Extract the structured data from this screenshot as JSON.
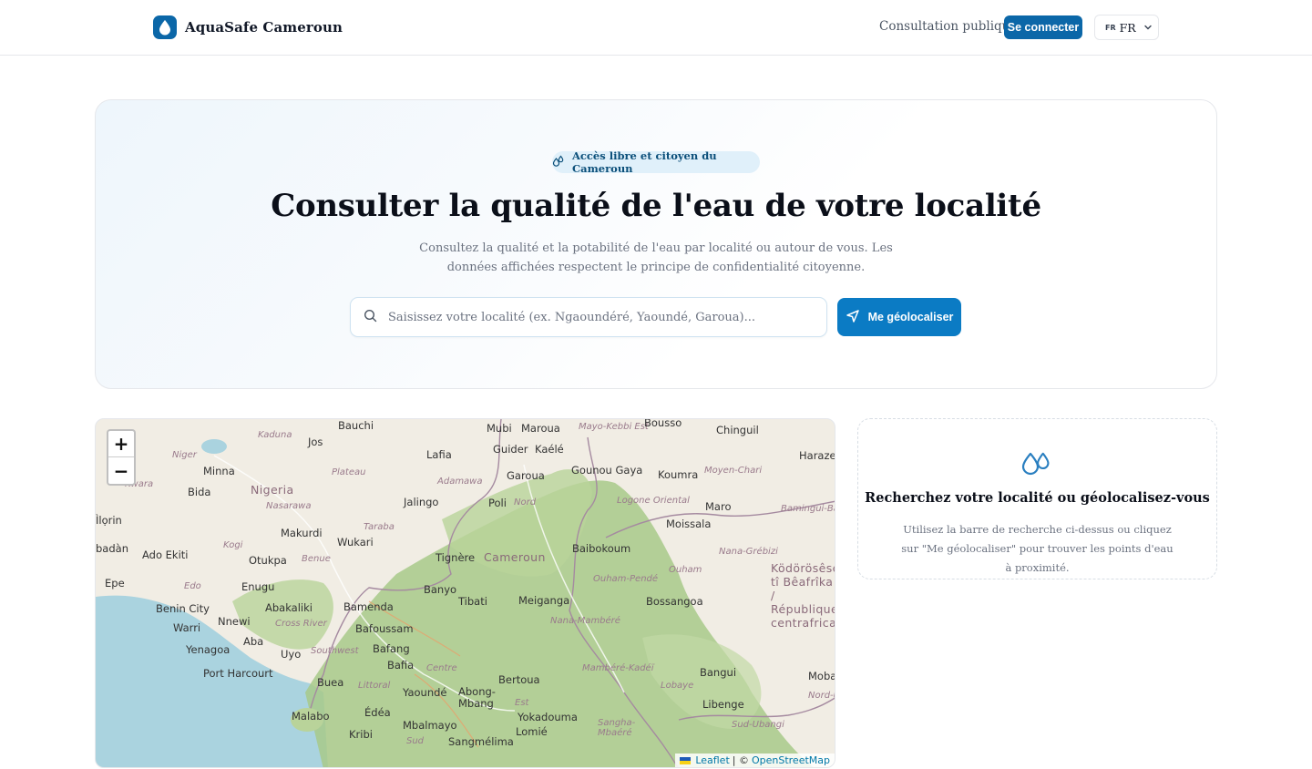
{
  "header": {
    "brand_name": "AquaSafe Cameroun",
    "nav_public": "Consultation publique",
    "login_label": "Se connecter",
    "lang_flag": "FR",
    "lang_value": "FR"
  },
  "hero": {
    "badge": "Accès libre et citoyen du Cameroun",
    "title": "Consulter la qualité de l'eau de votre localité",
    "subtitle": "Consultez la qualité et la potabilité de l'eau par localité ou autour de vous. Les données affichées respectent le principe de confidentialité citoyenne.",
    "search_placeholder": "Saisissez votre localité (ex. Ngaoundéré, Yaoundé, Garoua)...",
    "geo_button": "Me géolocaliser"
  },
  "map": {
    "zoom_in": "+",
    "zoom_out": "−",
    "attribution": {
      "leaflet": "Leaflet",
      "separator": "| ©",
      "osm": "OpenStreetMap"
    },
    "labels": {
      "bauchi": "Bauchi",
      "kaduna": "Kaduna",
      "jos": "Jos",
      "niger": "Niger",
      "minna": "Minna",
      "plateau": "Plateau",
      "lafia": "Lafia",
      "nigeria": "Nigeria",
      "bida": "Bida",
      "kwara": "Kwara",
      "nasarawa": "Nasarawa",
      "ilorin": "Ìlọrin",
      "makurdi": "Makurdi",
      "taraba": "Taraba",
      "kogi": "Kogi",
      "wukari": "Wukari",
      "ibadan": "badàn",
      "ado_ekiti": "Ado Ekiti",
      "otukpa": "Otukpa",
      "benue": "Benue",
      "epe": "Epe",
      "edo": "Edo",
      "enugu": "Enugu",
      "benin_city": "Benin City",
      "abakaliki": "Abakaliki",
      "warri": "Warri",
      "nnewi": "Nnewi",
      "cross_river": "Cross River",
      "yenagoa": "Yenagoa",
      "aba": "Aba",
      "uyo": "Uyo",
      "port_harcourt": "Port Harcourt",
      "mubi": "Mubi",
      "maroua": "Maroua",
      "mayo_kebbi": "Mayo-Kebbi Est",
      "bousso": "Bousso",
      "chinguil": "Chinguil",
      "guider": "Guider",
      "kaele": "Kaélé",
      "adamawa": "Adamawa",
      "garoua": "Garoua",
      "gounou_gaya": "Gounou Gaya",
      "koumra": "Koumra",
      "moyen_chari": "Moyen-Chari",
      "haraze": "Haraze",
      "jalingo": "Jalingo",
      "poli": "Poli",
      "nord": "Nord",
      "logone": "Logone Oriental",
      "maro": "Maro",
      "bamingui": "Bamingui-Bangoran",
      "moissala": "Moissala",
      "tignere": "Tignère",
      "cameroun": "Cameroun",
      "baibokoum": "Baibokoum",
      "nana_grebizi": "Nana-Grébizi",
      "banyo": "Banyo",
      "ouham_pende": "Ouham-Pendé",
      "ouham": "Ouham",
      "car": "Ködörösêse tî Bêafrîka / République centrafricaine",
      "bamenda": "Bamenda",
      "tibati": "Tibati",
      "meiganga": "Meiganga",
      "bossangoa": "Bossangoa",
      "bafoussam": "Bafoussam",
      "nana_mambere": "Nana-Mambéré",
      "southwest": "Southwest",
      "bafang": "Bafang",
      "bafia": "Bafia",
      "centre": "Centre",
      "bertoua": "Bertoua",
      "mambere_kadei": "Mambéré-Kadéï",
      "buea": "Buea",
      "littoral": "Littoral",
      "lobaye": "Lobaye",
      "bangui": "Bangui",
      "mobaye": "Mobay",
      "yaounde": "Yaoundé",
      "abong_mbang": "Abong-Mbang",
      "est": "Est",
      "libenge": "Libenge",
      "nord_u": "Nord-U",
      "malabo": "Malabo",
      "edea": "Édéa",
      "yokadouma": "Yokadouma",
      "sud_ubangi": "Sud-Ubangi",
      "mbalmayo": "Mbalmayo",
      "sangha": "Sangha-Mbaéré",
      "kribi": "Kribi",
      "lomie": "Lomié",
      "sud": "Sud",
      "sangmelima": "Sangmélima"
    }
  },
  "side_card": {
    "title": "Recherchez votre localité ou géolocalisez-vous",
    "text": "Utilisez la barre de recherche ci-dessus ou cliquez sur \"Me géolocaliser\" pour trouver les points d'eau à proximité."
  },
  "colors": {
    "primary": "#0b67a8",
    "primary_button": "#0b7bc4",
    "badge_bg": "#e0f0fa"
  },
  "icons": {
    "brand": "water-drop-icon",
    "badge": "droplets-icon",
    "search": "search-icon",
    "geo": "navigation-icon",
    "side": "droplets-icon",
    "lang": "chevron-down-icon"
  }
}
